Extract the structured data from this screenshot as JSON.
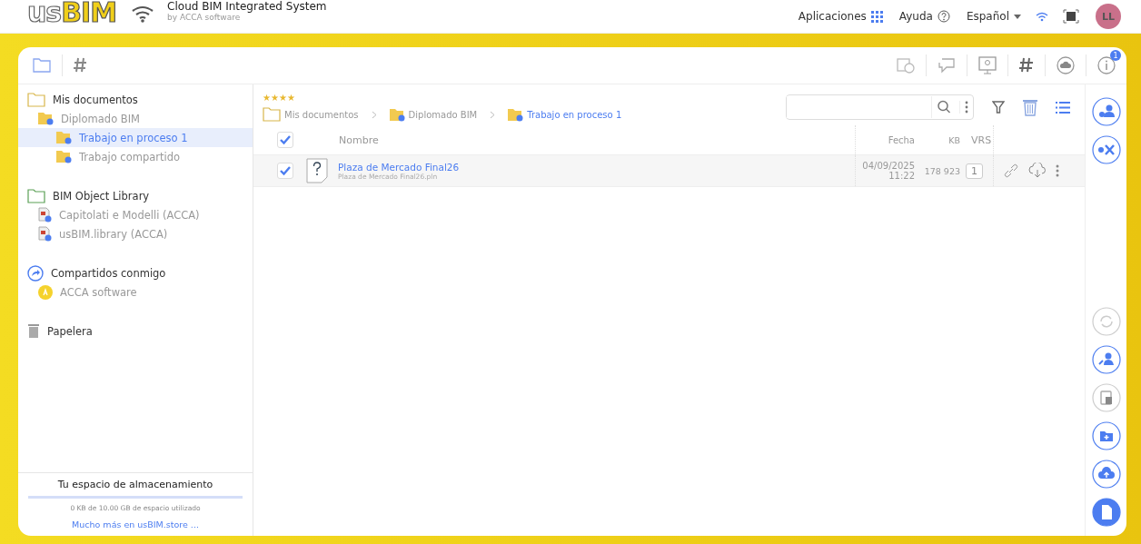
{
  "header": {
    "logo": [
      "us",
      "BIM"
    ],
    "title": "Cloud BIM Integrated System",
    "subtitle": "by ACCA software",
    "apps_label": "Aplicaciones",
    "help_label": "Ayuda",
    "language": "Español",
    "avatar": "LL"
  },
  "toolbar": {
    "notification_count": "1"
  },
  "sidebar": {
    "items": [
      {
        "label": "Mis documentos",
        "kind": "folder",
        "selected": false,
        "children": [
          {
            "label": "Diplomado BIM",
            "kind": "shared-folder",
            "selected": false,
            "children": [
              {
                "label": "Trabajo en proceso 1",
                "kind": "shared-folder",
                "selected": true
              },
              {
                "label": "Trabajo compartido",
                "kind": "shared-folder",
                "selected": false
              }
            ]
          }
        ]
      },
      {
        "label": "BIM Object Library",
        "kind": "library",
        "selected": false,
        "children": [
          {
            "label": "Capitolati e Modelli (ACCA)",
            "kind": "doc",
            "selected": false
          },
          {
            "label": "usBIM.library (ACCA)",
            "kind": "doc",
            "selected": false
          }
        ]
      },
      {
        "label": "Compartidos conmigo",
        "kind": "shared",
        "selected": false,
        "children": [
          {
            "label": "ACCA software",
            "kind": "user",
            "selected": false
          }
        ]
      },
      {
        "label": "Papelera",
        "kind": "trash",
        "selected": false
      }
    ],
    "storage": {
      "title": "Tu espacio de almacenamiento",
      "level": 0,
      "usage": "0 KB de 10.00 GB de espacio utilizado",
      "link": "Mucho más en usBIM.store ..."
    }
  },
  "content": {
    "rating": {
      "stars": 4
    },
    "breadcrumbs": [
      {
        "label": "Mis documentos",
        "kind": "folder",
        "selected": false
      },
      {
        "label": "Diplomado BIM",
        "kind": "shared-folder",
        "selected": false
      },
      {
        "label": "Trabajo en proceso 1",
        "kind": "shared-folder",
        "selected": true
      }
    ],
    "table": {
      "all_checked": true,
      "columns": [
        "Nombre",
        "Fecha",
        "KB",
        "VRS"
      ],
      "rows": [
        {
          "checked": true,
          "name": "Plaza de Mercado Final26",
          "file": "Plaza de Mercado Final26.pln",
          "date": "04/09/2025",
          "time": "11:22",
          "kb": "178 923",
          "vrs": "1"
        }
      ]
    }
  }
}
